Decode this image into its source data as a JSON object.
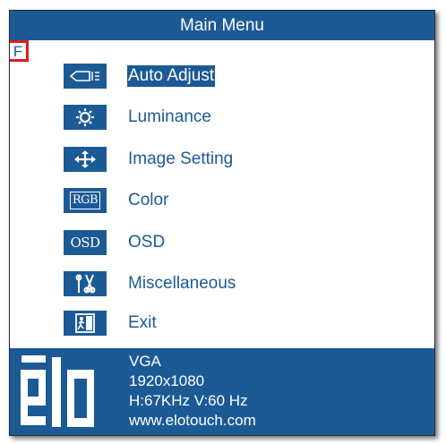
{
  "menu": {
    "title": "Main Menu",
    "badge": "F",
    "items": [
      {
        "label": "Auto Adjust",
        "icon": "auto-adjust-icon",
        "selected": true
      },
      {
        "label": "Luminance",
        "icon": "sun-icon",
        "selected": false
      },
      {
        "label": "Image Setting",
        "icon": "move-arrows-icon",
        "selected": false
      },
      {
        "label": "Color",
        "icon": "rgb-icon",
        "icon_text": "RGB",
        "selected": false
      },
      {
        "label": "OSD",
        "icon": "osd-icon",
        "icon_text": "OSD",
        "selected": false
      },
      {
        "label": "Miscellaneous",
        "icon": "tools-icon",
        "selected": false
      },
      {
        "label": "Exit",
        "icon": "exit-door-icon",
        "selected": false
      }
    ]
  },
  "status": {
    "logo_text": "ēlo",
    "input": "VGA",
    "resolution": "1920x1080",
    "frequency": "H:67KHz  V:60 Hz",
    "website": "www.elotouch.com"
  },
  "colors": {
    "accent": "#1c5a96",
    "badge_border": "#e4191f",
    "background": "#ffffff"
  }
}
